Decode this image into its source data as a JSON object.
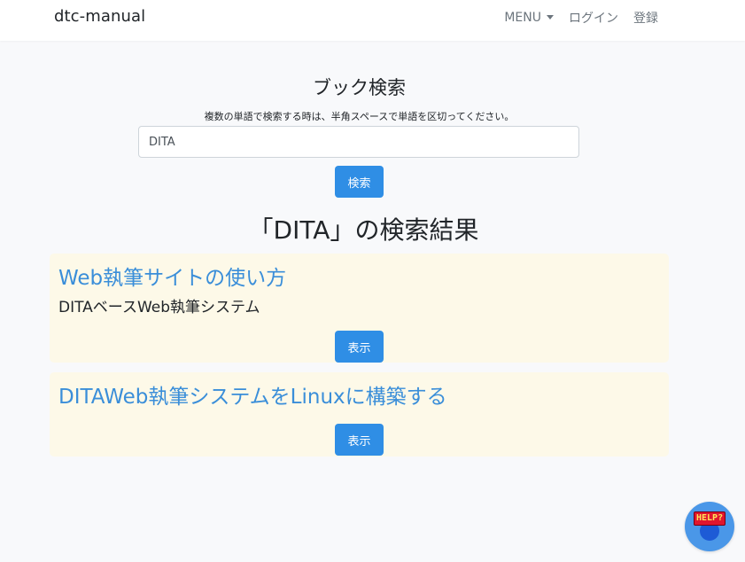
{
  "navbar": {
    "brand": "dtc-manual",
    "menu_label": "MENU",
    "login_label": "ログイン",
    "register_label": "登録"
  },
  "search": {
    "title": "ブック検索",
    "hint": "複数の単語で検索する時は、半角スペースで単語を区切ってください。",
    "value": "DITA",
    "button_label": "検索"
  },
  "results": {
    "heading": "「DITA」の検索結果",
    "items": [
      {
        "title": "Web執筆サイトの使い方",
        "description": "DITAベースWeb執筆システム",
        "button_label": "表示"
      },
      {
        "title": "DITAWeb執筆システムをLinuxに構築する",
        "description": "",
        "button_label": "表示"
      }
    ]
  },
  "help": {
    "badge": "HELP?"
  },
  "colors": {
    "accent": "#2f8ee5",
    "link": "#3a8ed9",
    "card_background": "#fdf9e8",
    "page_background": "#f8f9fb"
  }
}
